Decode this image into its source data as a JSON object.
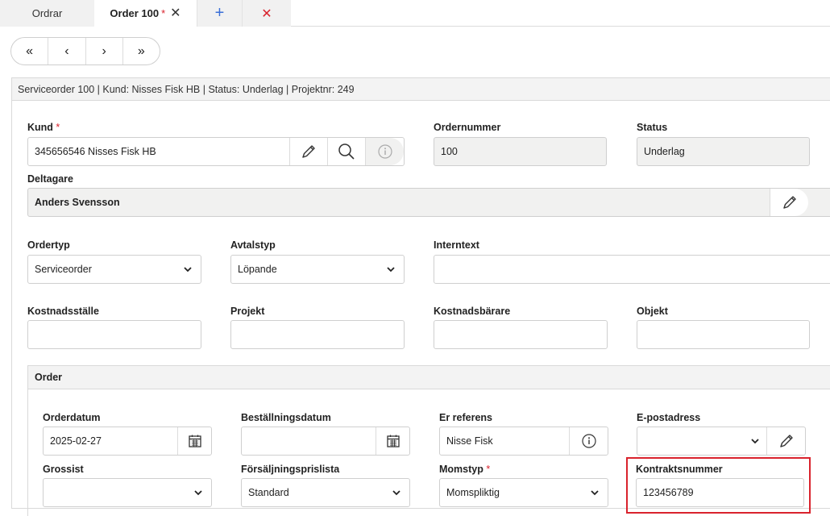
{
  "tabs": {
    "ordrar": "Ordrar",
    "order": "Order 100",
    "required_mark": "*",
    "close_glyph": "✕",
    "add_glyph": "+",
    "close_all_glyph": "✕"
  },
  "nav": {
    "first": "«",
    "prev": "‹",
    "next": "›",
    "last": "»"
  },
  "header": {
    "summary": "Serviceorder 100 | Kund: Nisses Fisk HB | Status: Underlag | Projektnr: 249"
  },
  "fields": {
    "kund": {
      "label": "Kund",
      "required": "*",
      "value": "345656546 Nisses Fisk HB"
    },
    "ordernummer": {
      "label": "Ordernummer",
      "value": "100"
    },
    "status": {
      "label": "Status",
      "value": "Underlag"
    },
    "deltagare": {
      "label": "Deltagare",
      "value": "Anders Svensson"
    },
    "ordertyp": {
      "label": "Ordertyp",
      "value": "Serviceorder"
    },
    "avtalstyp": {
      "label": "Avtalstyp",
      "value": "Löpande"
    },
    "interntext": {
      "label": "Interntext",
      "value": ""
    },
    "kostnadsstalle": {
      "label": "Kostnadsställe",
      "value": ""
    },
    "projekt": {
      "label": "Projekt",
      "value": ""
    },
    "kostnadsbarare": {
      "label": "Kostnadsbärare",
      "value": ""
    },
    "objekt": {
      "label": "Objekt",
      "value": ""
    }
  },
  "order": {
    "title": "Order",
    "orderdatum": {
      "label": "Orderdatum",
      "value": "2025-02-27"
    },
    "bestallningsdatum": {
      "label": "Beställningsdatum",
      "value": ""
    },
    "er_referens": {
      "label": "Er referens",
      "value": "Nisse Fisk"
    },
    "epostadress": {
      "label": "E-postadress",
      "value": ""
    },
    "grossist": {
      "label": "Grossist",
      "value": ""
    },
    "forsaljningsprislista": {
      "label": "Försäljningsprislista",
      "value": "Standard"
    },
    "momstyp": {
      "label": "Momstyp",
      "required": "*",
      "value": "Momspliktig"
    },
    "kontraktsnummer": {
      "label": "Kontraktsnummer",
      "value": "123456789"
    }
  },
  "colors": {
    "accent_blue": "#3a6fd8",
    "required_red": "#d9232d",
    "readonly_bg": "#f1f1f0"
  }
}
